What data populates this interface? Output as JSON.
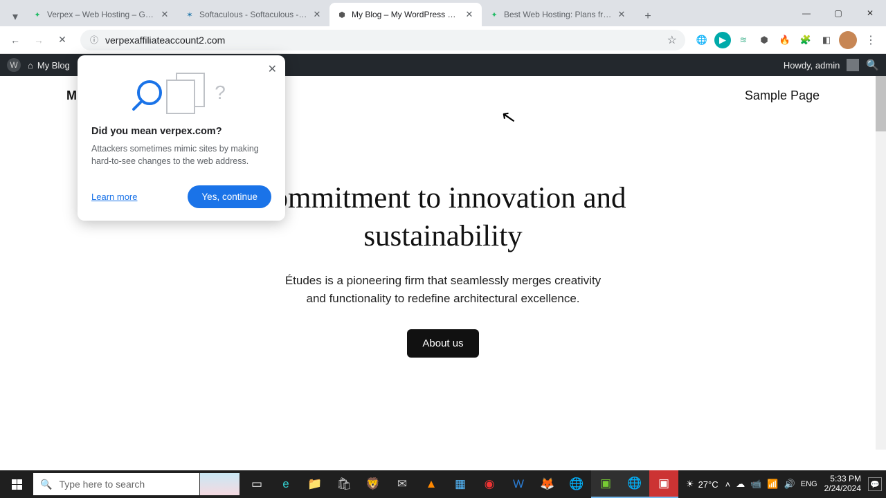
{
  "browser": {
    "tabs": [
      {
        "title": "Verpex – Web Hosting – Gold",
        "favicon": "✦"
      },
      {
        "title": "Softaculous - Softaculous - Wo",
        "favicon": "✶"
      },
      {
        "title": "My Blog – My WordPress Blog",
        "favicon": "⬢",
        "active": true
      },
      {
        "title": "Best Web Hosting: Plans from $",
        "favicon": "✦"
      }
    ],
    "url": "verpexaffiliateaccount2.com"
  },
  "wp_bar": {
    "site_name": "My Blog",
    "greeting": "Howdy, admin"
  },
  "site": {
    "title_visible": "M",
    "nav_link": "Sample Page",
    "hero_heading": "commitment to innovation and sustainability",
    "hero_body": "Études is a pioneering firm that seamlessly merges creativity and functionality to redefine architectural excellence.",
    "hero_button": "About us"
  },
  "sb_popup": {
    "title": "Did you mean verpex.com?",
    "body": "Attackers sometimes mimic sites by making hard-to-see changes to the web address.",
    "learn": "Learn more",
    "continue": "Yes, continue"
  },
  "taskbar": {
    "search_placeholder": "Type here to search",
    "weather_temp": "27°C",
    "time": "5:33 PM",
    "date": "2/24/2024"
  }
}
